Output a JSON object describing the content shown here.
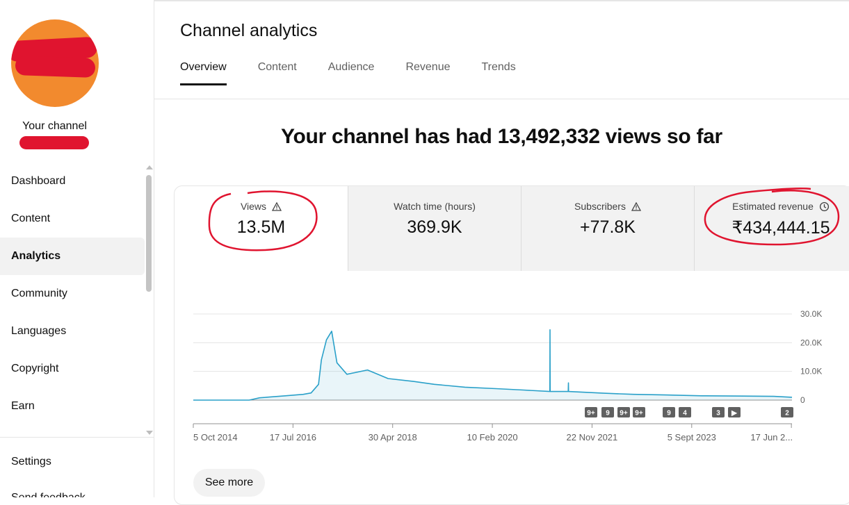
{
  "sidebar": {
    "channel_label": "Your channel",
    "items": [
      {
        "label": "Dashboard",
        "active": false
      },
      {
        "label": "Content",
        "active": false
      },
      {
        "label": "Analytics",
        "active": true
      },
      {
        "label": "Community",
        "active": false
      },
      {
        "label": "Languages",
        "active": false
      },
      {
        "label": "Copyright",
        "active": false
      },
      {
        "label": "Earn",
        "active": false
      }
    ],
    "settings_label": "Settings",
    "feedback_label": "Send feedback"
  },
  "page": {
    "title": "Channel analytics",
    "tabs": [
      "Overview",
      "Content",
      "Audience",
      "Revenue",
      "Trends"
    ],
    "active_tab": "Overview",
    "headline": "Your channel has had 13,492,332 views so far"
  },
  "metrics": [
    {
      "label": "Views",
      "value": "13.5M",
      "icon": "warning-icon"
    },
    {
      "label": "Watch time (hours)",
      "value": "369.9K",
      "icon": ""
    },
    {
      "label": "Subscribers",
      "value": "+77.8K",
      "icon": "warning-icon"
    },
    {
      "label": "Estimated revenue",
      "value": "₹434,444.15",
      "icon": "clock-icon"
    }
  ],
  "chart_data": {
    "type": "area",
    "title": "",
    "xlabel": "",
    "ylabel": "",
    "x_tick_labels": [
      "5 Oct 2014",
      "17 Jul 2016",
      "30 Apr 2018",
      "10 Feb 2020",
      "22 Nov 2021",
      "5 Sept 2023",
      "17 Jun 2..."
    ],
    "y_tick_labels": [
      "30.0K",
      "20.0K",
      "10.0K",
      "0"
    ],
    "ylim": [
      0,
      30000
    ],
    "series": [
      {
        "color": "#29a0c9",
        "x": [
          "2014-10-05",
          "2015-09-01",
          "2015-11-01",
          "2016-04-01",
          "2016-07-17",
          "2016-09-01",
          "2016-10-15",
          "2016-11-01",
          "2016-12-01",
          "2017-01-01",
          "2017-02-01",
          "2017-04-01",
          "2017-08-01",
          "2017-12-01",
          "2018-04-30",
          "2018-09-01",
          "2019-03-01",
          "2019-09-01",
          "2020-02-10",
          "2020-07-15",
          "2020-07-16",
          "2020-07-17",
          "2020-11-01",
          "2020-11-02",
          "2020-11-03",
          "2021-06-01",
          "2021-11-22",
          "2022-06-01",
          "2023-01-01",
          "2023-09-05",
          "2024-03-01",
          "2024-06-17"
        ],
        "values": [
          0,
          0,
          800,
          1500,
          2000,
          2500,
          5500,
          14000,
          21000,
          24000,
          13000,
          9000,
          10500,
          7500,
          6500,
          5500,
          4500,
          4000,
          3500,
          3000,
          24500,
          3000,
          3000,
          6000,
          3000,
          2400,
          2000,
          1800,
          1500,
          1400,
          1300,
          1000
        ]
      }
    ],
    "grid": true,
    "legend": "none",
    "event_badges": [
      "9+",
      "9",
      "9+",
      "9+",
      "9",
      "4",
      "3",
      "▶",
      "2"
    ]
  },
  "buttons": {
    "see_more": "See more"
  },
  "colors": {
    "accent": "#29a0c9",
    "annotation": "#e0142f"
  }
}
